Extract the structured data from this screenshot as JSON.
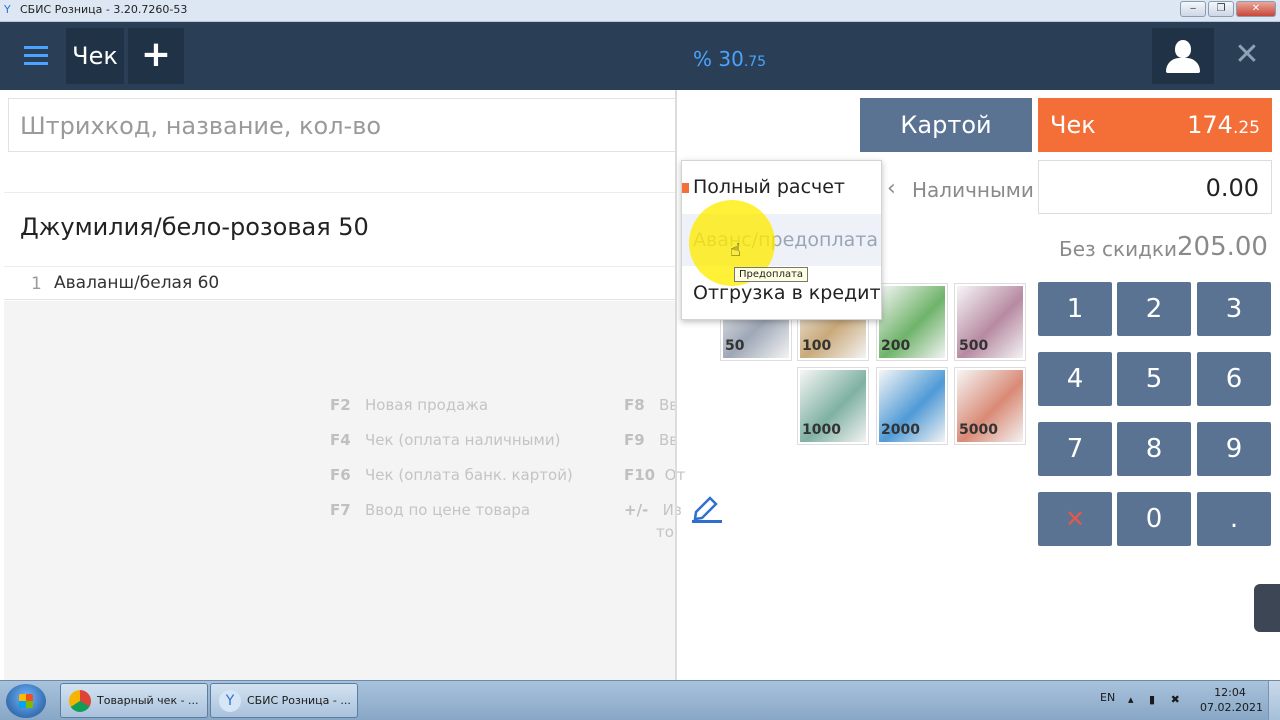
{
  "window": {
    "title": "СБИС Розница - 3.20.7260-53"
  },
  "left_panel": {
    "tab_label": "Чек",
    "plus_label": "+",
    "search_placeholder": "Штрихкод, название, кол-во",
    "group_title": "Джумилия/бело-розовая 50",
    "items": [
      {
        "num": "1",
        "name": "Аваланш/белая 60"
      }
    ],
    "hotkeys": [
      {
        "key": "F2",
        "label": "Новая продажа"
      },
      {
        "key": "F4",
        "label": "Чек (оплата наличными)"
      },
      {
        "key": "F6",
        "label": "Чек (оплата банк. картой)"
      },
      {
        "key": "F7",
        "label": "Ввод по цене товара"
      },
      {
        "key": "F8",
        "label": "Вв"
      },
      {
        "key": "F9",
        "label": "Вв"
      },
      {
        "key": "F10",
        "label": "От"
      },
      {
        "key": "+/-",
        "label": "Из"
      },
      {
        "key": "",
        "label": "то"
      }
    ]
  },
  "right_panel": {
    "discount_prefix": "%",
    "discount_main": "30",
    "discount_fraction": ".75",
    "card_button": "Картой",
    "check_label": "Чек",
    "check_amount_main": "174",
    "check_amount_fraction": ".25",
    "cash_label": "Наличными",
    "cash_value": "0.00",
    "no_discount_label": "Без скидки",
    "no_discount_value": "205.00",
    "keypad": [
      "1",
      "2",
      "3",
      "4",
      "5",
      "6",
      "7",
      "8",
      "9",
      "✕",
      "0",
      "."
    ],
    "bills": [
      "50",
      "100",
      "200",
      "500",
      "1000",
      "2000",
      "5000"
    ],
    "bill_colors": {
      "50": "#9ea7b6",
      "100": "#c9a97a",
      "200": "#6fb36a",
      "500": "#b78aa2",
      "1000": "#7fb1a2",
      "2000": "#4f9ad6",
      "5000": "#d98a76"
    }
  },
  "dropdown": {
    "items": [
      "Полный расчет",
      "Аванс/предоплата",
      "Отгрузка в кредит"
    ],
    "tooltip": "Предоплата"
  },
  "taskbar": {
    "tasks": [
      "Товарный чек - ...",
      "СБИС Розница - ..."
    ],
    "lang": "EN",
    "time": "12:04",
    "date": "07.02.2021"
  },
  "colors": {
    "header_bg": "#2a3f55",
    "accent_blue": "#4aa3ff",
    "button_blue": "#5a7393",
    "check_orange": "#f46e37"
  }
}
